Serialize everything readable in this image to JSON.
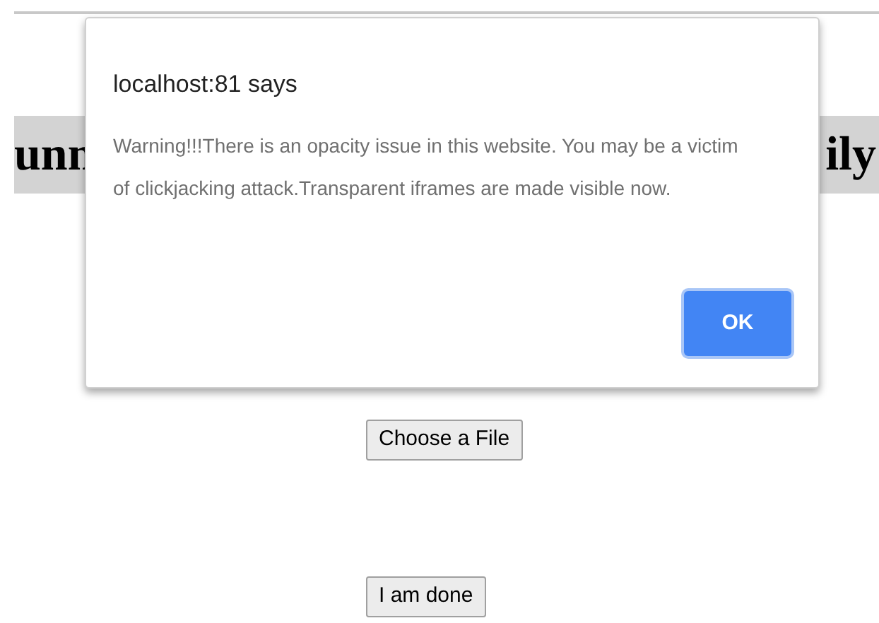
{
  "heading": {
    "left_fragment": "unn",
    "right_fragment": "ily"
  },
  "dialog": {
    "title": "localhost:81 says",
    "message": "Warning!!!There is an opacity issue in this website. You may be a victim of clickjacking attack.Transparent iframes are made visible now.",
    "ok_button": "OK"
  },
  "buttons": [
    "Choose a File",
    "I am done"
  ]
}
